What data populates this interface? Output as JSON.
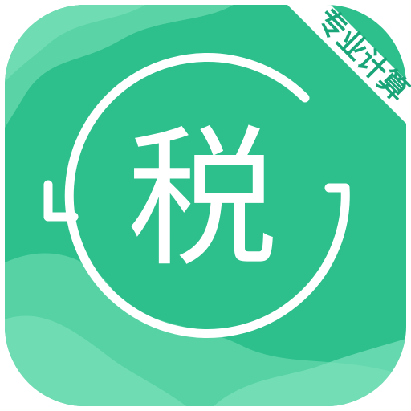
{
  "icon": {
    "banner_text": "专业计算",
    "glyph": "税",
    "colors": {
      "background": "#2dbf8c",
      "wave_light": "#5fd5a9",
      "wave_lighter": "#7fe2bd",
      "banner": "#ffffff",
      "banner_text": "#1aa579",
      "glyph": "#ffffff"
    }
  }
}
